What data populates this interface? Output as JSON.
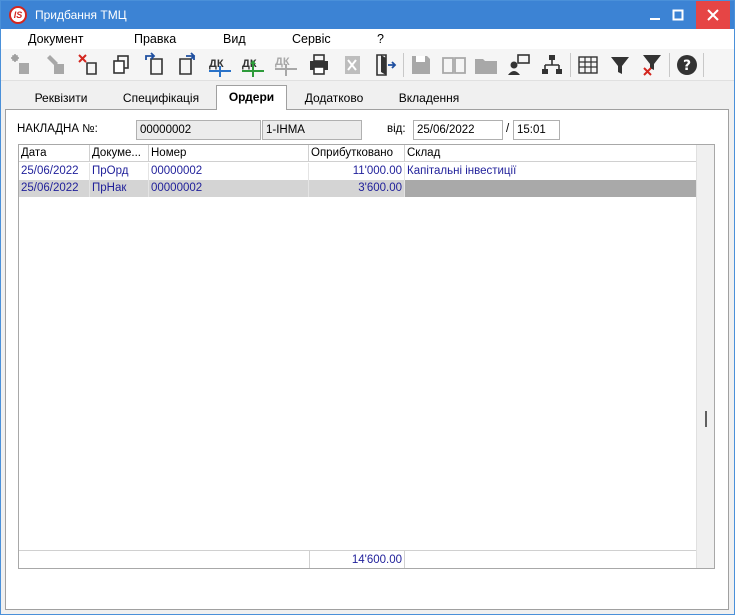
{
  "window": {
    "title": "Придбання ТМЦ",
    "app_icon_text": "IS",
    "colors": {
      "titlebar": "#3c83d4",
      "close": "#e64545",
      "link_text": "#1f1f9a",
      "accent_green": "#2e9b3a",
      "accent_red": "#d3261f"
    }
  },
  "menu": {
    "items": [
      "Документ",
      "Правка",
      "Вид",
      "Сервіс",
      "?"
    ]
  },
  "toolbar": {
    "icons": [
      "add-icon",
      "edit-icon",
      "delete-icon",
      "copy-icon",
      "import-icon",
      "export-icon",
      "dk-blue-icon",
      "dk-green-icon",
      "dk-grey-icon",
      "print-icon",
      "excel-icon",
      "exit-icon",
      "save-icon",
      "book-icon",
      "folder-icon",
      "users-icon",
      "tree-icon",
      "grid-icon",
      "filter-icon",
      "filter-clear-icon",
      "help-icon"
    ],
    "dk_label": "ДК"
  },
  "tabs": [
    {
      "label": "Реквізити",
      "active": false
    },
    {
      "label": "Специфікація",
      "active": false
    },
    {
      "label": "Ордери",
      "active": true
    },
    {
      "label": "Додатково",
      "active": false
    },
    {
      "label": "Вкладення",
      "active": false
    }
  ],
  "header": {
    "invoice_label": "НАКЛАДНА №:",
    "invoice_number": "00000002",
    "invoice_code": "1-ІНМА",
    "date_label": "від:",
    "date": "25/06/2022",
    "separator": "/",
    "time": "15:01"
  },
  "table": {
    "columns": [
      "Дата",
      "Докуме...",
      "Номер",
      "Оприбутковано",
      "Склад"
    ],
    "rows": [
      {
        "date": "25/06/2022",
        "doc": "ПрОрд",
        "number": "00000002",
        "amount": "11'000.00",
        "warehouse": "Капітальні інвестиції",
        "selected": false
      },
      {
        "date": "25/06/2022",
        "doc": "ПрНак",
        "number": "00000002",
        "amount": "3'600.00",
        "warehouse": "",
        "selected": true
      }
    ],
    "total": "14'600.00"
  }
}
